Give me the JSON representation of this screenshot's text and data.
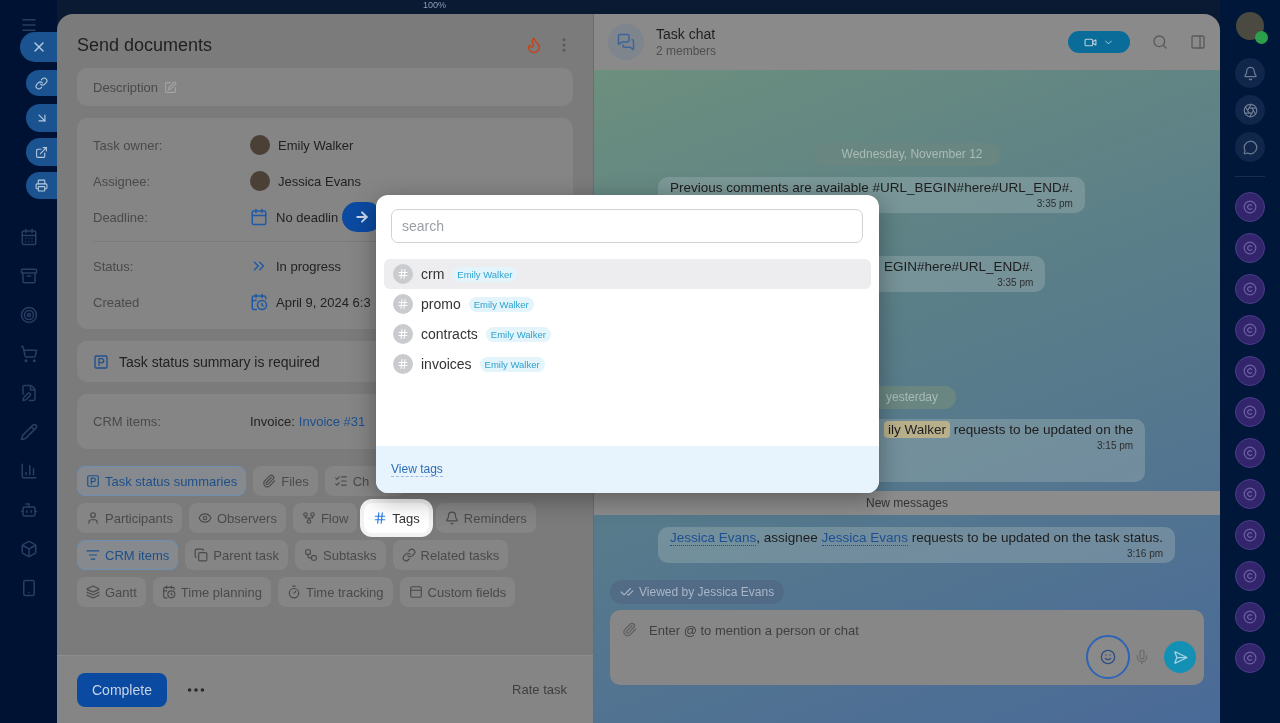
{
  "top_bar": {
    "zoom": "100%"
  },
  "task": {
    "title": "Send documents",
    "description_placeholder": "Description",
    "details_primary": [
      {
        "label": "Task owner:",
        "kind": "person",
        "value": "Emily Walker"
      },
      {
        "label": "Assignee:",
        "kind": "person",
        "value": "Jessica Evans"
      },
      {
        "label": "Deadline:",
        "kind": "deadline",
        "value": "No deadlin"
      }
    ],
    "details_secondary": [
      {
        "label": "Status:",
        "kind": "status",
        "value": "In progress"
      },
      {
        "label": "Created",
        "kind": "created",
        "value": "April 9, 2024 6:3"
      }
    ],
    "notice": "Task status summary is required",
    "crm": {
      "label": "CRM items:",
      "prefix": "Invoice:",
      "link": "Invoice #31"
    },
    "chip_rows": [
      [
        {
          "label": "Task status summaries",
          "active": true,
          "highlighted": false
        },
        {
          "label": "Files",
          "active": false,
          "highlighted": false
        },
        {
          "label": "Ch",
          "active": false,
          "highlighted": false
        }
      ],
      [
        {
          "label": "Participants",
          "active": false,
          "highlighted": false
        },
        {
          "label": "Observers",
          "active": false,
          "highlighted": false
        },
        {
          "label": "Flow",
          "active": false,
          "highlighted": false
        },
        {
          "label": "Tags",
          "active": false,
          "highlighted": true
        },
        {
          "label": "Reminders",
          "active": false,
          "highlighted": false
        }
      ],
      [
        {
          "label": "CRM items",
          "active": true,
          "highlighted": false
        },
        {
          "label": "Parent task",
          "active": false,
          "highlighted": false
        },
        {
          "label": "Subtasks",
          "active": false,
          "highlighted": false
        },
        {
          "label": "Related tasks",
          "active": false,
          "highlighted": false
        }
      ],
      [
        {
          "label": "Gantt",
          "active": false,
          "highlighted": false
        },
        {
          "label": "Time planning",
          "active": false,
          "highlighted": false
        },
        {
          "label": "Time tracking",
          "active": false,
          "highlighted": false
        },
        {
          "label": "Custom fields",
          "active": false,
          "highlighted": false
        }
      ]
    ],
    "footer": {
      "complete": "Complete",
      "rate": "Rate task"
    }
  },
  "tag_popup": {
    "placeholder": "search",
    "footer_link": "View tags",
    "tags": [
      {
        "name": "crm",
        "author": "Emily Walker",
        "selected": true
      },
      {
        "name": "promo",
        "author": "Emily Walker",
        "selected": false
      },
      {
        "name": "contracts",
        "author": "Emily Walker",
        "selected": false
      },
      {
        "name": "invoices",
        "author": "Emily Walker",
        "selected": false
      }
    ]
  },
  "chat": {
    "title": "Task chat",
    "subtitle": "2 members",
    "input_placeholder": "Enter @ to mention a person or chat",
    "items": [
      {
        "kind": "date",
        "text": "Wednesday, November 12"
      },
      {
        "kind": "message",
        "segments": [
          {
            "kind": "plain",
            "text": "Previous comments are available #URL_BEGIN#here#URL_END#."
          }
        ],
        "time": "3:35 pm"
      },
      {
        "kind": "partial_message",
        "segments": [
          {
            "kind": "plain",
            "text": "EGIN#here#URL_END#."
          }
        ],
        "time": "3:35 pm"
      },
      {
        "kind": "date",
        "text": "yesterday"
      },
      {
        "kind": "partial_message",
        "segments": [
          {
            "kind": "self",
            "text": "ily Walker"
          },
          {
            "kind": "plain",
            "text": " requests to be updated on the"
          }
        ],
        "time": "3:15 pm"
      },
      {
        "kind": "divider",
        "text": "New messages"
      },
      {
        "kind": "message",
        "segments": [
          {
            "kind": "link",
            "text": "Jessica Evans"
          },
          {
            "kind": "plain",
            "text": ", assignee "
          },
          {
            "kind": "link",
            "text": "Jessica Evans"
          },
          {
            "kind": "plain",
            "text": " requests to be updated on the task status."
          }
        ],
        "time": "3:16 pm"
      },
      {
        "kind": "seen",
        "text": "Viewed by Jessica Evans"
      }
    ]
  }
}
